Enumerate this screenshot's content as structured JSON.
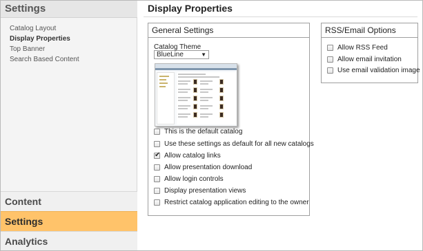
{
  "sidebar": {
    "header": "Settings",
    "items": [
      {
        "label": "Catalog Layout",
        "active": false
      },
      {
        "label": "Display Properties",
        "active": true
      },
      {
        "label": "Top Banner",
        "active": false
      },
      {
        "label": "Search Based Content",
        "active": false
      }
    ],
    "nav": {
      "content": "Content",
      "settings": "Settings",
      "analytics": "Analytics"
    },
    "active_nav_color": "#ffc36a"
  },
  "main": {
    "title": "Display Properties",
    "general": {
      "title": "General Settings",
      "theme_label": "Catalog Theme",
      "theme_value": "BlueLine",
      "options": [
        {
          "label": "This is the default catalog",
          "checked": false
        },
        {
          "label": "Use these settings as default for all new catalogs",
          "checked": false
        },
        {
          "label": "Allow catalog links",
          "checked": true
        },
        {
          "label": "Allow presentation download",
          "checked": false
        },
        {
          "label": "Allow login controls",
          "checked": false
        },
        {
          "label": "Display presentation views",
          "checked": false
        },
        {
          "label": "Restrict catalog application editing to the owner",
          "checked": false
        }
      ]
    },
    "rss": {
      "title": "RSS/Email Options",
      "options": [
        {
          "label": "Allow RSS Feed",
          "checked": false
        },
        {
          "label": "Allow email invitation",
          "checked": false
        },
        {
          "label": "Use email validation image",
          "checked": false
        }
      ]
    }
  },
  "icons": {
    "select_arrow": "chevron-down-icon",
    "checkmark": "check-icon"
  }
}
